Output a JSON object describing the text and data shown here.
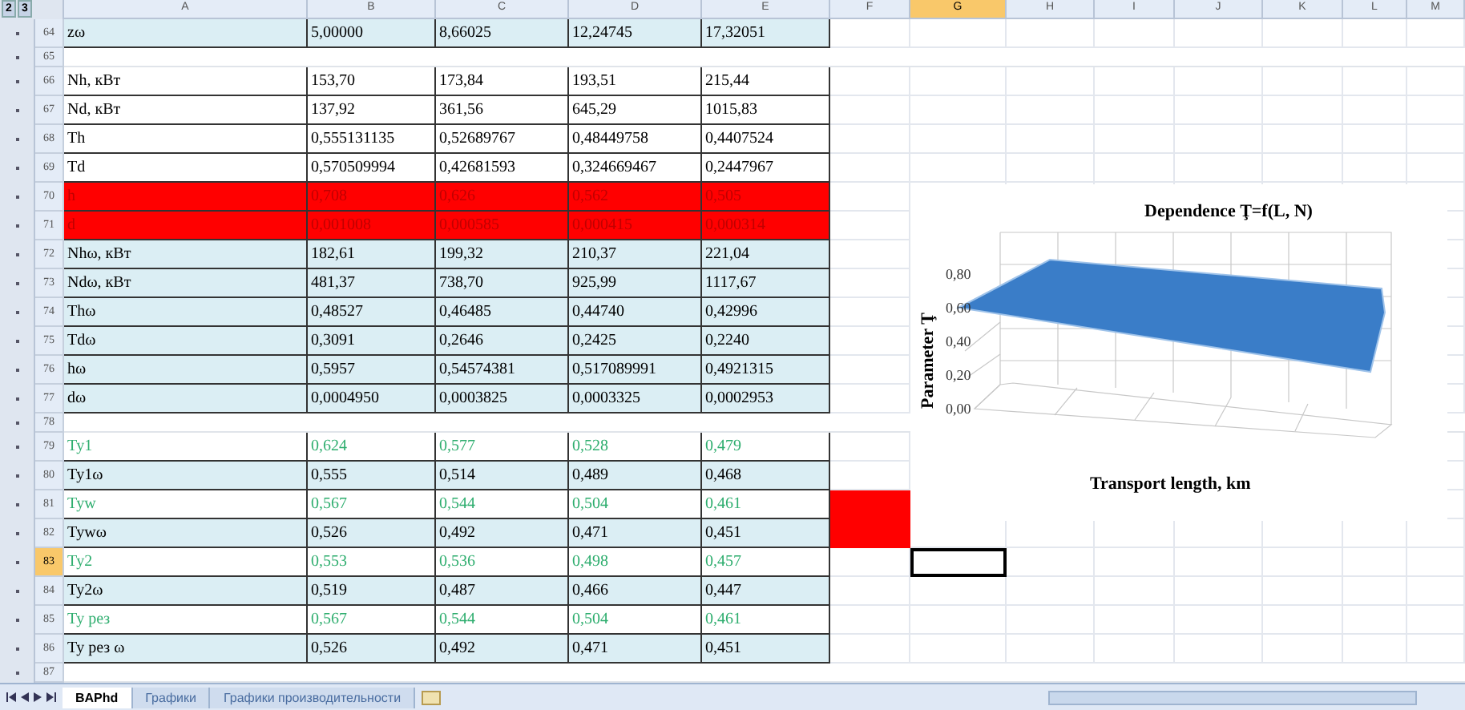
{
  "outline_levels": [
    "2",
    "3"
  ],
  "columns": [
    {
      "name": "A",
      "selected": false
    },
    {
      "name": "B",
      "selected": false
    },
    {
      "name": "C",
      "selected": false
    },
    {
      "name": "D",
      "selected": false
    },
    {
      "name": "E",
      "selected": false
    },
    {
      "name": "F",
      "selected": false
    },
    {
      "name": "G",
      "selected": true
    },
    {
      "name": "H",
      "selected": false
    },
    {
      "name": "I",
      "selected": false
    },
    {
      "name": "J",
      "selected": false
    },
    {
      "name": "K",
      "selected": false
    },
    {
      "name": "L",
      "selected": false
    },
    {
      "name": "M",
      "selected": false
    }
  ],
  "rows": [
    {
      "number": "64",
      "kind": "shaded",
      "accent": false,
      "flagged": false,
      "selected": false,
      "label": "zω",
      "values": [
        "5,00000",
        "8,66025",
        "12,24745",
        "17,32051"
      ]
    },
    {
      "number": "65",
      "kind": "blank",
      "selected": false
    },
    {
      "number": "66",
      "kind": "plain",
      "accent": false,
      "flagged": false,
      "selected": false,
      "label": "Nh, кВт",
      "values": [
        "153,70",
        "173,84",
        "193,51",
        "215,44"
      ]
    },
    {
      "number": "67",
      "kind": "plain",
      "accent": false,
      "flagged": false,
      "selected": false,
      "label": "Nd, кВт",
      "values": [
        "137,92",
        "361,56",
        "645,29",
        "1015,83"
      ]
    },
    {
      "number": "68",
      "kind": "plain",
      "accent": false,
      "flagged": false,
      "selected": false,
      "label": "Th",
      "values": [
        "0,555131135",
        "0,52689767",
        "0,48449758",
        "0,4407524"
      ]
    },
    {
      "number": "69",
      "kind": "plain",
      "accent": false,
      "flagged": false,
      "selected": false,
      "label": "Td",
      "values": [
        "0,570509994",
        "0,42681593",
        "0,324669467",
        "0,2447967"
      ]
    },
    {
      "number": "70",
      "kind": "alert",
      "flagged": false,
      "selected": false,
      "label": "h",
      "values": [
        "0,708",
        "0,626",
        "0,562",
        "0,505"
      ]
    },
    {
      "number": "71",
      "kind": "alert",
      "flagged": false,
      "selected": false,
      "label": "d",
      "values": [
        "0,001008",
        "0,000585",
        "0,000415",
        "0,000314"
      ]
    },
    {
      "number": "72",
      "kind": "shaded",
      "accent": false,
      "flagged": false,
      "selected": false,
      "label": "Nhω, кВт",
      "values": [
        "182,61",
        "199,32",
        "210,37",
        "221,04"
      ]
    },
    {
      "number": "73",
      "kind": "shaded",
      "accent": false,
      "flagged": false,
      "selected": false,
      "label": "Ndω, кВт",
      "values": [
        "481,37",
        "738,70",
        "925,99",
        "1117,67"
      ]
    },
    {
      "number": "74",
      "kind": "shaded",
      "accent": false,
      "flagged": false,
      "selected": false,
      "label": "Thω",
      "values": [
        "0,48527",
        "0,46485",
        "0,44740",
        "0,42996"
      ]
    },
    {
      "number": "75",
      "kind": "shaded",
      "accent": false,
      "flagged": false,
      "selected": false,
      "label": "Tdω",
      "values": [
        "0,3091",
        "0,2646",
        "0,2425",
        "0,2240"
      ]
    },
    {
      "number": "76",
      "kind": "shaded",
      "accent": false,
      "flagged": false,
      "selected": false,
      "label": "hω",
      "values": [
        "0,5957",
        "0,54574381",
        "0,517089991",
        "0,4921315"
      ]
    },
    {
      "number": "77",
      "kind": "shaded",
      "accent": false,
      "flagged": false,
      "selected": false,
      "label": "dω",
      "values": [
        "0,0004950",
        "0,0003825",
        "0,0003325",
        "0,0002953"
      ]
    },
    {
      "number": "78",
      "kind": "blank",
      "selected": false
    },
    {
      "number": "79",
      "kind": "plain",
      "accent": true,
      "flagged": false,
      "selected": false,
      "label": "Ту1",
      "values": [
        "0,624",
        "0,577",
        "0,528",
        "0,479"
      ]
    },
    {
      "number": "80",
      "kind": "shaded",
      "accent": false,
      "flagged": false,
      "selected": false,
      "label": "Ту1ω",
      "values": [
        "0,555",
        "0,514",
        "0,489",
        "0,468"
      ]
    },
    {
      "number": "81",
      "kind": "plain",
      "accent": true,
      "flagged": true,
      "selected": false,
      "label": "Туw",
      "values": [
        "0,567",
        "0,544",
        "0,504",
        "0,461"
      ]
    },
    {
      "number": "82",
      "kind": "shaded",
      "accent": false,
      "flagged": true,
      "selected": false,
      "label": "Туwω",
      "values": [
        "0,526",
        "0,492",
        "0,471",
        "0,451"
      ]
    },
    {
      "number": "83",
      "kind": "plain",
      "accent": true,
      "flagged": false,
      "selected": true,
      "label": "Ту2",
      "values": [
        "0,553",
        "0,536",
        "0,498",
        "0,457"
      ]
    },
    {
      "number": "84",
      "kind": "shaded",
      "accent": false,
      "flagged": false,
      "selected": false,
      "label": "Ту2ω",
      "values": [
        "0,519",
        "0,487",
        "0,466",
        "0,447"
      ]
    },
    {
      "number": "85",
      "kind": "plain",
      "accent": true,
      "flagged": false,
      "selected": false,
      "label": "Ту рез",
      "values": [
        "0,567",
        "0,544",
        "0,504",
        "0,461"
      ]
    },
    {
      "number": "86",
      "kind": "shaded",
      "accent": false,
      "flagged": false,
      "selected": false,
      "label": "Ту рез ω",
      "values": [
        "0,526",
        "0,492",
        "0,471",
        "0,451"
      ]
    },
    {
      "number": "87",
      "kind": "blank",
      "selected": false
    }
  ],
  "chart": {
    "title": "Dependence Ţ=f(L, N)",
    "ylabel": "Parameter Ţ",
    "xlabel": "Transport length, km",
    "yticks": [
      "0,80",
      "0,60",
      "0,40",
      "0,20",
      "0,00"
    ]
  },
  "sheet_tabs": [
    {
      "label": "BAPhd",
      "selected": true
    },
    {
      "label": "Графики",
      "selected": false
    },
    {
      "label": "Графики производительности",
      "selected": false
    }
  ]
}
